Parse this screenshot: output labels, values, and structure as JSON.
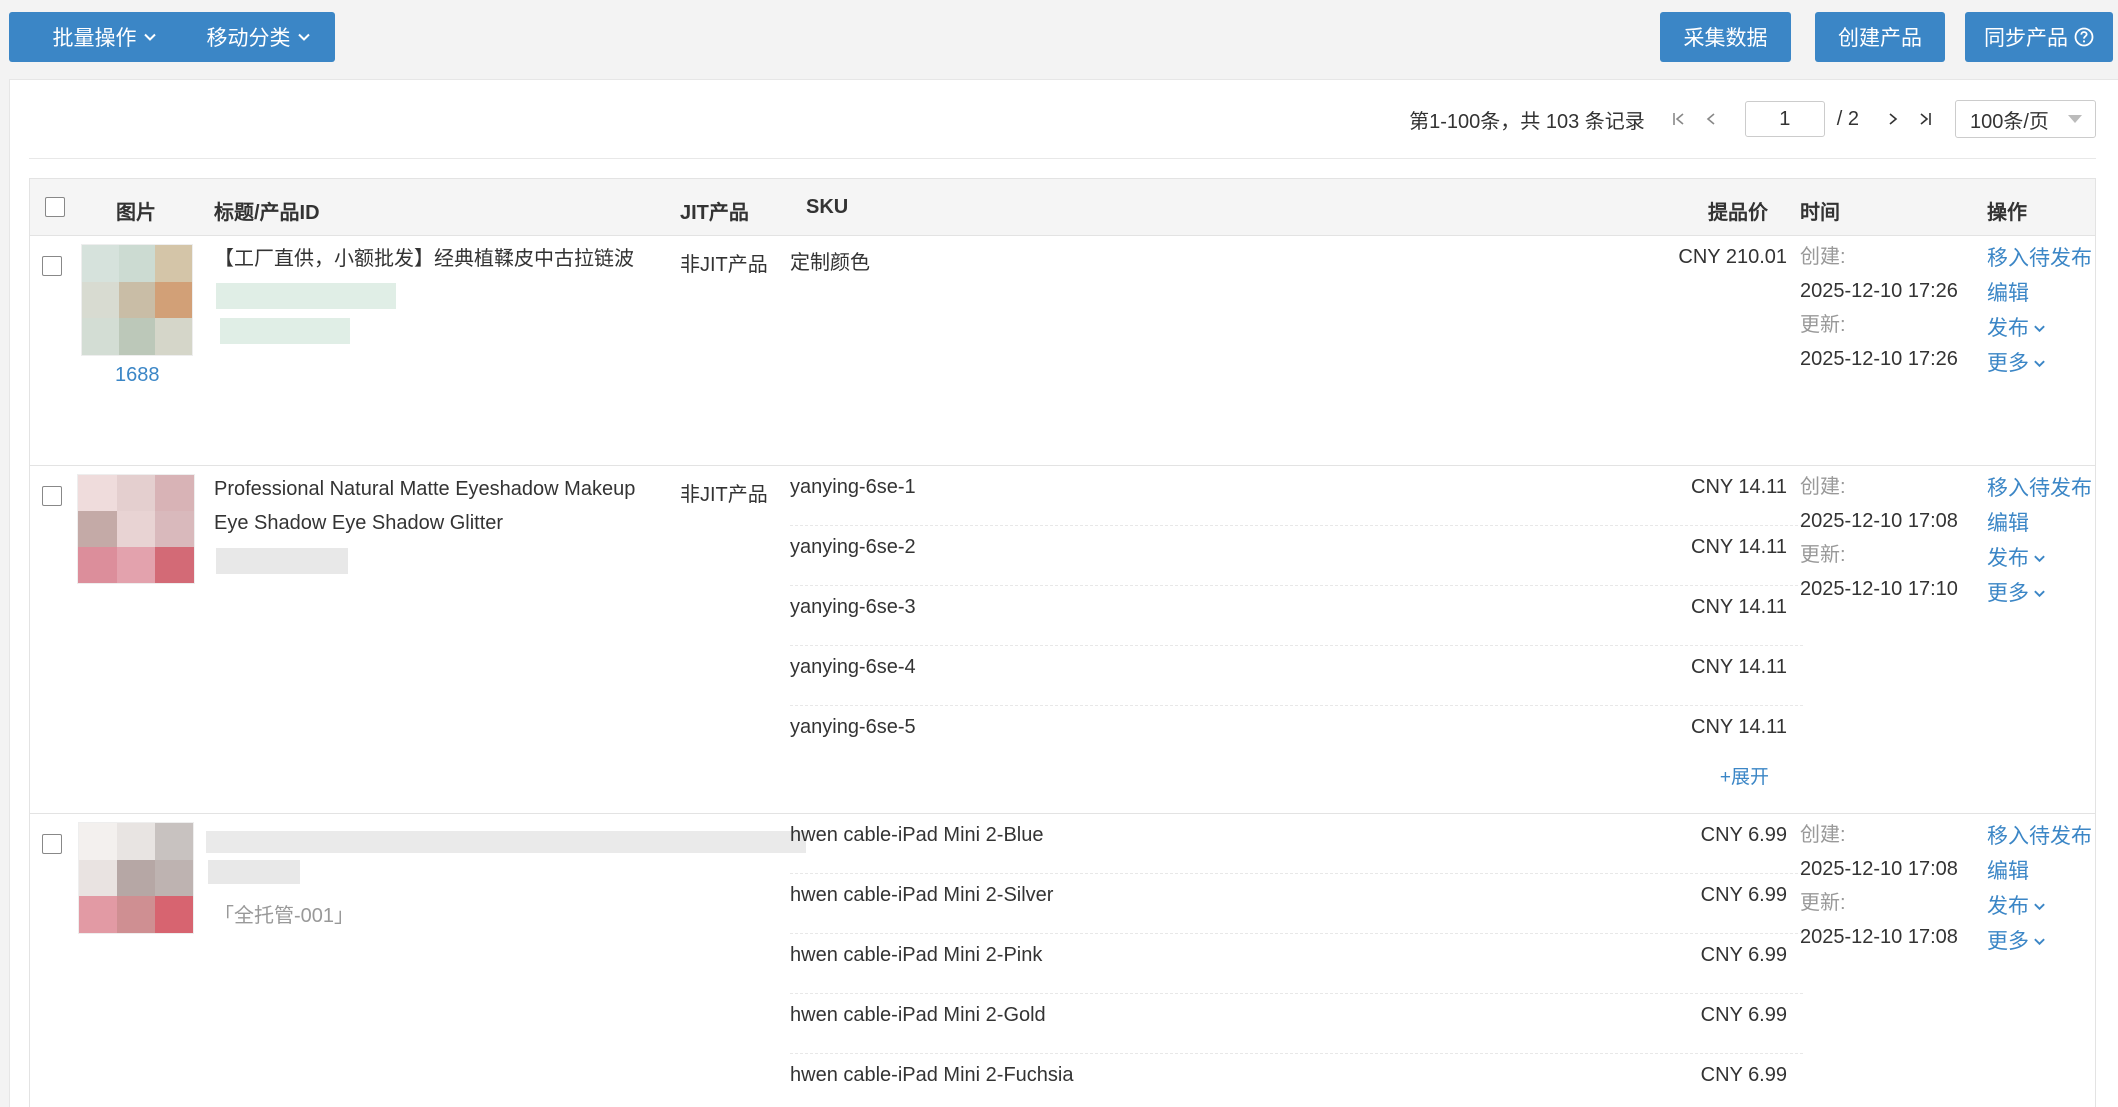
{
  "toolbar": {
    "batch_label": "批量操作",
    "move_label": "移动分类",
    "collect_label": "采集数据",
    "create_label": "创建产品",
    "sync_label": "同步产品"
  },
  "pager": {
    "summary": "第1-100条，共 103 条记录",
    "page": "1",
    "total_pages": "/ 2",
    "page_size": "100条/页"
  },
  "table": {
    "headers": {
      "image": "图片",
      "title": "标题/产品ID",
      "jit": "JIT产品",
      "sku": "SKU",
      "price": "提品价",
      "time": "时间",
      "ops": "操作"
    },
    "labels": {
      "created": "创建:",
      "updated": "更新:",
      "move_pending": "移入待发布",
      "edit": "编辑",
      "publish": "发布",
      "more": "更多",
      "expand": "+展开"
    },
    "rows": [
      {
        "source": "1688",
        "title": "【工厂直供，小额批发】经典植鞣皮中古拉链波",
        "jit": "非JIT产品",
        "skus": [
          {
            "name": "定制颜色",
            "price": "CNY 210.01"
          }
        ],
        "created": "2025-12-10 17:26",
        "updated": "2025-12-10 17:26"
      },
      {
        "title_line1": "Professional Natural Matte Eyeshadow Makeup",
        "title_line2": "Eye Shadow Eye Shadow Glitter",
        "jit": "非JIT产品",
        "skus": [
          {
            "name": "yanying-6se-1",
            "price": "CNY 14.11"
          },
          {
            "name": "yanying-6se-2",
            "price": "CNY 14.11"
          },
          {
            "name": "yanying-6se-3",
            "price": "CNY 14.11"
          },
          {
            "name": "yanying-6se-4",
            "price": "CNY 14.11"
          },
          {
            "name": "yanying-6se-5",
            "price": "CNY 14.11"
          }
        ],
        "created": "2025-12-10 17:08",
        "updated": "2025-12-10 17:10"
      },
      {
        "tag": "「全托管-001」",
        "skus": [
          {
            "name": "hwen cable-iPad Mini 2-Blue",
            "price": "CNY 6.99"
          },
          {
            "name": "hwen cable-iPad Mini 2-Silver",
            "price": "CNY 6.99"
          },
          {
            "name": "hwen cable-iPad Mini 2-Pink",
            "price": "CNY 6.99"
          },
          {
            "name": "hwen cable-iPad Mini 2-Gold",
            "price": "CNY 6.99"
          },
          {
            "name": "hwen cable-iPad Mini 2-Fuchsia",
            "price": "CNY 6.99"
          }
        ],
        "created": "2025-12-10 17:08",
        "updated": "2025-12-10 17:08"
      }
    ]
  },
  "icons": {
    "chevron": "chevron-down-icon",
    "help": "question-circle-icon",
    "first": "first-page-icon",
    "prev": "prev-page-icon",
    "next": "next-page-icon",
    "last": "last-page-icon"
  },
  "colors": {
    "accent": "#3b86c6",
    "link": "#3b86c6"
  }
}
